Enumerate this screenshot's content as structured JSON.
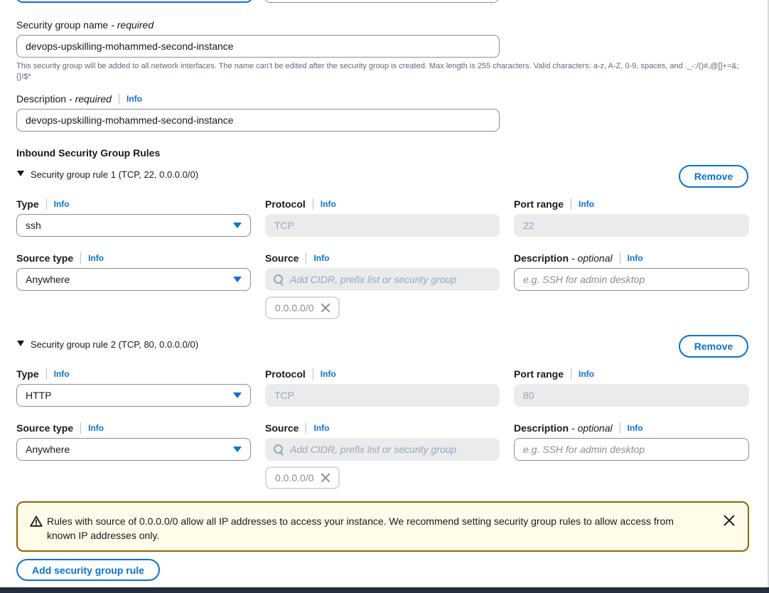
{
  "security_group_name": {
    "label": "Security group name",
    "required": "- required",
    "value": "devops-upskilling-mohammed-second-instance",
    "hint": "This security group will be added to all network interfaces. The name can't be edited after the security group is created. Max length is 255 characters. Valid characters: a-z, A-Z, 0-9, spaces, and ._-:/()#,@[]+=&;{}!$*"
  },
  "description": {
    "label": "Description",
    "required": "- required",
    "info": "Info",
    "value": "devops-upskilling-mohammed-second-instance"
  },
  "inbound": {
    "title": "Inbound Security Group Rules",
    "rules": [
      {
        "header": "Security group rule 1 (TCP, 22, 0.0.0.0/0)",
        "remove_label": "Remove",
        "type_label": "Type",
        "type_value": "ssh",
        "protocol_label": "Protocol",
        "protocol_value": "TCP",
        "port_label": "Port range",
        "port_value": "22",
        "source_type_label": "Source type",
        "source_type_value": "Anywhere",
        "source_label": "Source",
        "source_placeholder": "Add CIDR, prefix list or security group",
        "source_token": "0.0.0.0/0",
        "desc_label": "Description",
        "desc_optional": "- optional",
        "desc_placeholder": "e.g. SSH for admin desktop"
      },
      {
        "header": "Security group rule 2 (TCP, 80, 0.0.0.0/0)",
        "remove_label": "Remove",
        "type_label": "Type",
        "type_value": "HTTP",
        "protocol_label": "Protocol",
        "protocol_value": "TCP",
        "port_label": "Port range",
        "port_value": "80",
        "source_type_label": "Source type",
        "source_type_value": "Anywhere",
        "source_label": "Source",
        "source_placeholder": "Add CIDR, prefix list or security group",
        "source_token": "0.0.0.0/0",
        "desc_label": "Description",
        "desc_optional": "- optional",
        "desc_placeholder": "e.g. SSH for admin desktop"
      }
    ]
  },
  "info_label": "Info",
  "alert": {
    "message": "Rules with source of 0.0.0.0/0 allow all IP addresses to access your instance. We recommend setting security group rules to allow access from known IP addresses only."
  },
  "add_rule_label": "Add security group rule",
  "icons": {
    "warning": "warning-icon",
    "close": "close-icon",
    "search": "search-icon",
    "dropdown": "chevron-down-icon",
    "expand": "caret-down-icon"
  },
  "colors": {
    "link": "#0972d3",
    "warning_border": "#8d6605",
    "warning_bg": "#fffce9",
    "disabled_bg": "#e9ebed"
  }
}
